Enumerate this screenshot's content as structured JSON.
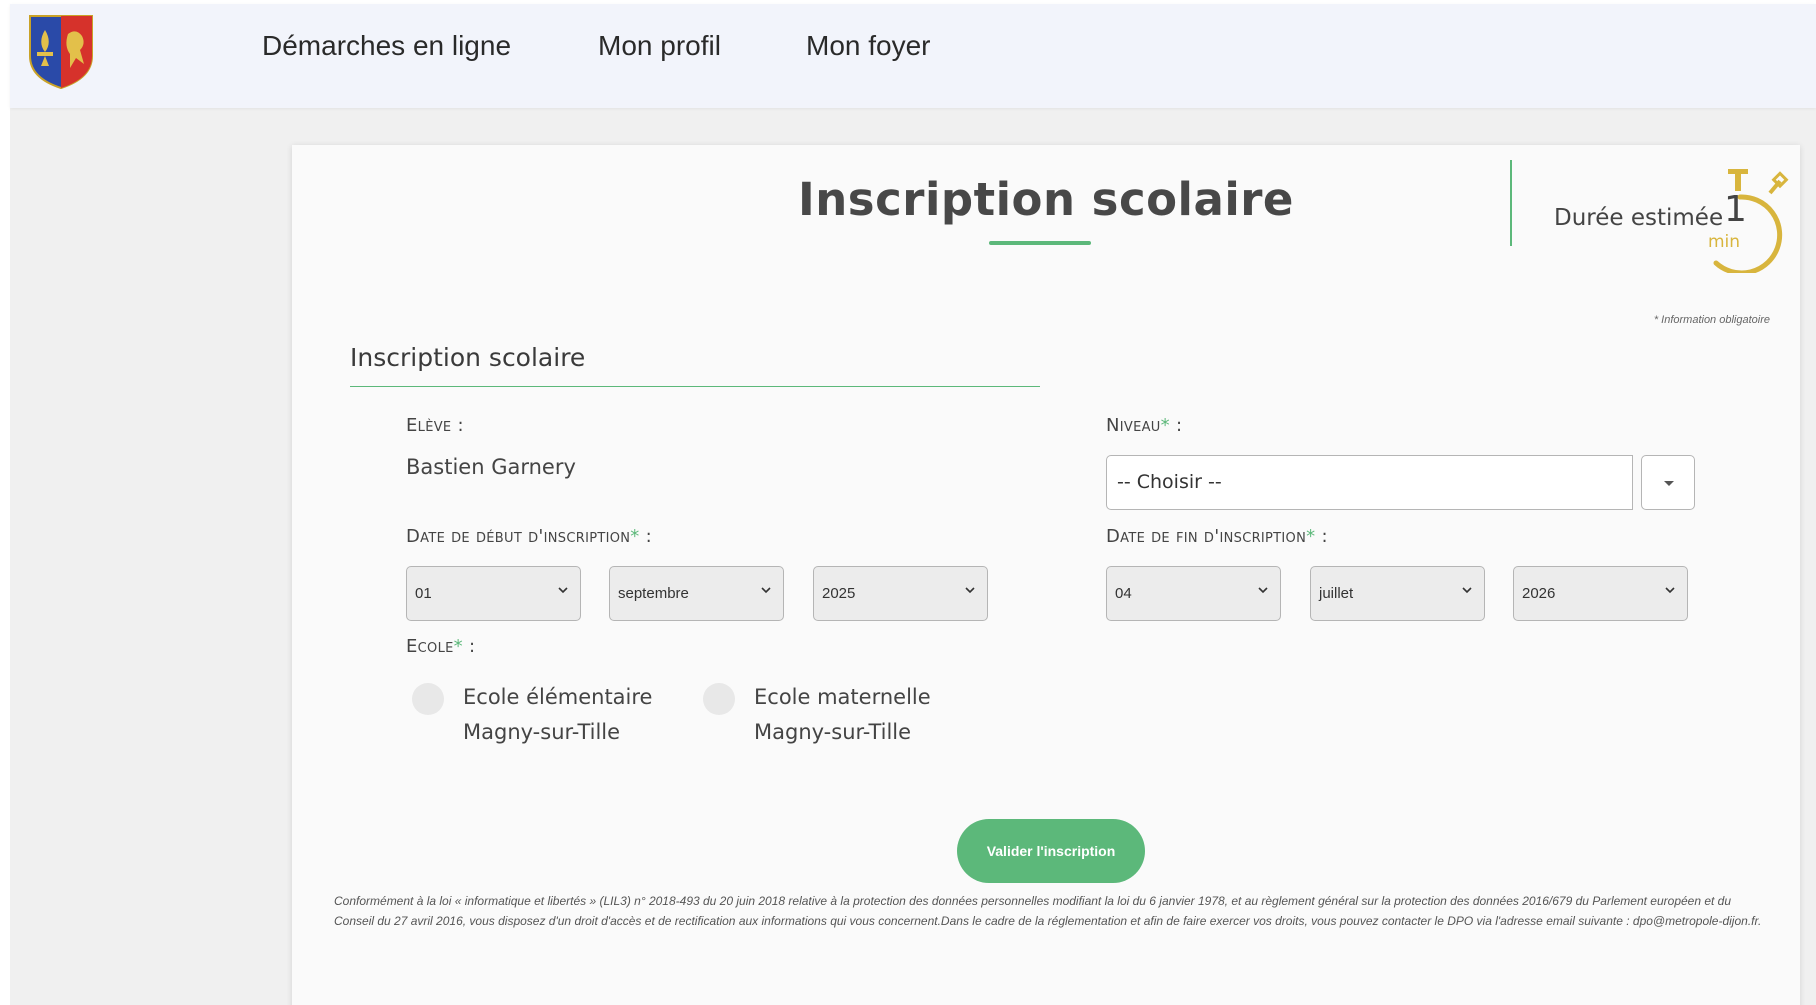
{
  "nav": {
    "logo_icon": "coat-of-arms-icon",
    "items": [
      "Démarches en ligne",
      "Mon profil",
      "Mon foyer"
    ]
  },
  "page": {
    "title": "Inscription scolaire",
    "duration_label": "Durée estimée",
    "duration_value": "1",
    "duration_unit": "min",
    "duration_icon": "stopwatch-icon",
    "mandatory_note": "* Information obligatoire"
  },
  "section": {
    "title": "Inscription scolaire"
  },
  "form": {
    "eleve_label": "Elève",
    "eleve_value": "Bastien Garnery",
    "niveau_label": "Niveau",
    "niveau_value": "-- Choisir --",
    "start_label": "Date de début d'inscription",
    "start_day": "01",
    "start_month": "septembre",
    "start_year": "2025",
    "end_label": "Date de fin d'inscription",
    "end_day": "04",
    "end_month": "juillet",
    "end_year": "2026",
    "ecole_label": "Ecole",
    "schools": [
      {
        "line1": "Ecole élémentaire",
        "line2": "Magny-sur-Tille"
      },
      {
        "line1": "Ecole maternelle",
        "line2": "Magny-sur-Tille"
      }
    ],
    "required_mark": "*",
    "colon": " :",
    "submit_label": "Valider l'inscription"
  },
  "legal_text": "Conformément à la loi « informatique et libertés » (LIL3) n° 2018-493 du 20 juin 2018 relative à la protection des données personnelles modifiant la loi du 6 janvier 1978, et au règlement général sur la protection des données 2016/679 du Parlement européen et du Conseil du 27 avril 2016, vous disposez d'un droit d'accès et de rectification aux informations qui vous concernent.Dans le cadre de la réglementation et afin de faire exercer vos droits, vous pouvez contacter le DPO via l'adresse email suivante : dpo@metropole-dijon.fr.",
  "colors": {
    "accent": "#5cb87a",
    "gold": "#d8b53d",
    "navbar": "#f2f4fb"
  }
}
